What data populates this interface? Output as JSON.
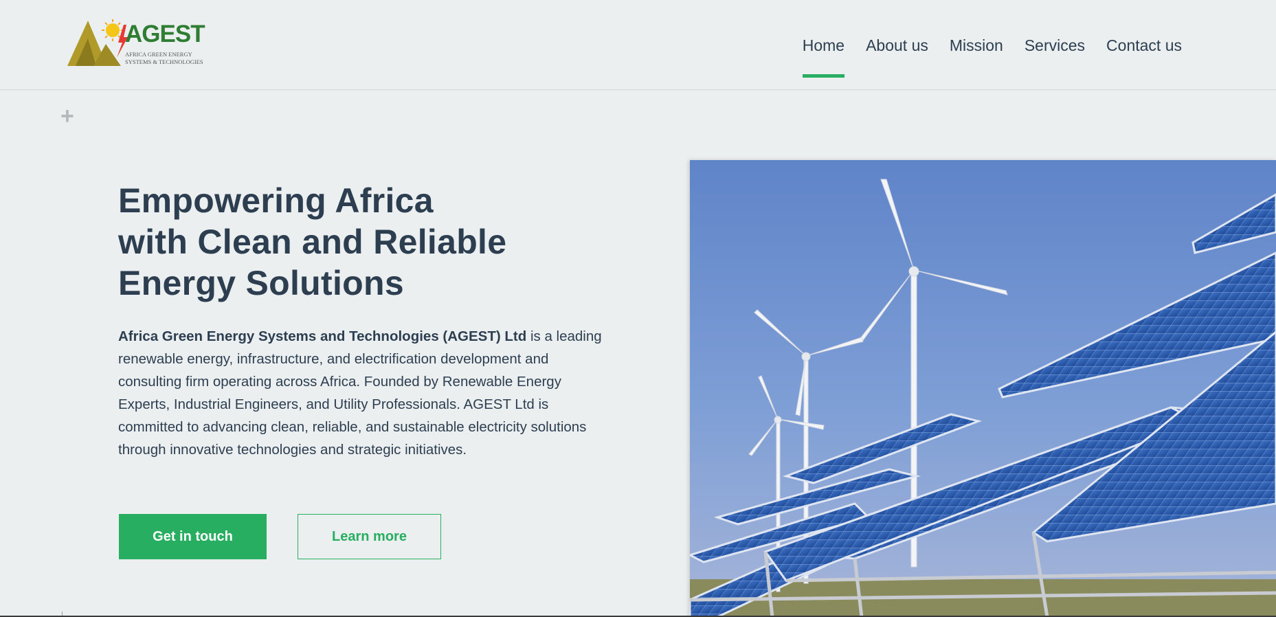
{
  "logo": {
    "word": "AGEST",
    "sub_line1": "AFRICA GREEN ENERGY",
    "sub_line2": "SYSTEMS & TECHNOLOGIES",
    "colors": {
      "green": "#2e7d32",
      "olive": "#b09a2a",
      "sun": "#f5c518",
      "bolt": "#e53935"
    }
  },
  "nav": {
    "items": [
      {
        "label": "Home",
        "active": true
      },
      {
        "label": "About us",
        "active": false
      },
      {
        "label": "Mission",
        "active": false
      },
      {
        "label": "Services",
        "active": false
      },
      {
        "label": "Contact us",
        "active": false
      }
    ],
    "active_color": "#27ae60"
  },
  "icons": {
    "expand": "plus-icon"
  },
  "hero": {
    "title_line1": "Empowering Africa",
    "title_line2": "with Clean and Reliable",
    "title_line3": "Energy Solutions",
    "description_bold": "Africa Green Energy Systems and Technologies (AGEST) Ltd",
    "description_rest": " is a leading renewable energy, infrastructure, and electrification development and consulting firm operating across Africa. Founded by Renewable Energy Experts, Industrial Engineers, and Utility Professionals. AGEST Ltd is committed to advancing clean, reliable, and sustainable electricity solutions through innovative technologies and strategic initiatives.",
    "primary_button": "Get in touch",
    "secondary_button": "Learn more",
    "image_alt": "solar panels and wind turbines"
  },
  "colors": {
    "background": "#eceff0",
    "text": "#2c3e50",
    "accent": "#27ae60"
  }
}
